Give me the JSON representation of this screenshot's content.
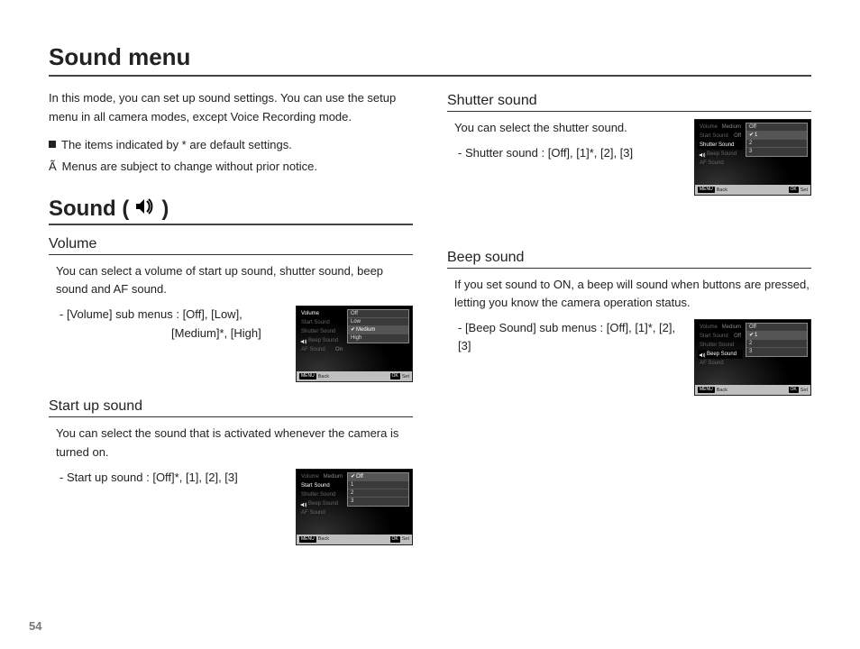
{
  "page_number": "54",
  "title": "Sound menu",
  "intro": "In this mode, you can set up sound settings. You can use the setup menu in all camera modes, except Voice Recording mode.",
  "note_default": "The items indicated by * are default settings.",
  "note_change_prefix": "Ã",
  "note_change": "Menus are subject to change without prior notice.",
  "sound_heading": {
    "pre": "Sound (",
    "post": ")"
  },
  "volume": {
    "heading": "Volume",
    "para": "You can select a volume of start up sound, shutter sound, beep sound and AF sound.",
    "sub_line1": "- [Volume] sub menus : [Off], [Low],",
    "sub_line2": "[Medium]*, [High]"
  },
  "startup": {
    "heading": "Start up sound",
    "para": "You can select the sound that is activated whenever the camera is turned on.",
    "sub": "- Start up sound : [Off]*, [1], [2], [3]"
  },
  "shutter": {
    "heading": "Shutter sound",
    "para": "You can select the shutter sound.",
    "sub": "- Shutter sound : [Off], [1]*, [2], [3]"
  },
  "beep": {
    "heading": "Beep sound",
    "para": "If you set sound to ON, a beep will sound when buttons are pressed, letting you know the camera operation status.",
    "sub": "- [Beep Sound] sub menus : [Off], [1]*, [2], [3]"
  },
  "menu_labels": {
    "volume": "Volume",
    "start": "Start Sound",
    "shutter": "Shutter Sound",
    "beep": "Beep Sound",
    "af": "AF Sound",
    "back": "Back",
    "set": "Set",
    "menu_btn": "MENU",
    "ok_btn": "OK",
    "val_medium": "Medium",
    "val_off": "Off",
    "val_on": "On"
  },
  "opts_volume": {
    "o0": "Off",
    "o1": "Low",
    "o2": "Medium",
    "o3": "High",
    "sel": "Medium"
  },
  "opts_0123": {
    "o0": "Off",
    "o1": "1",
    "o2": "2",
    "o3": "3"
  },
  "check": "✔"
}
